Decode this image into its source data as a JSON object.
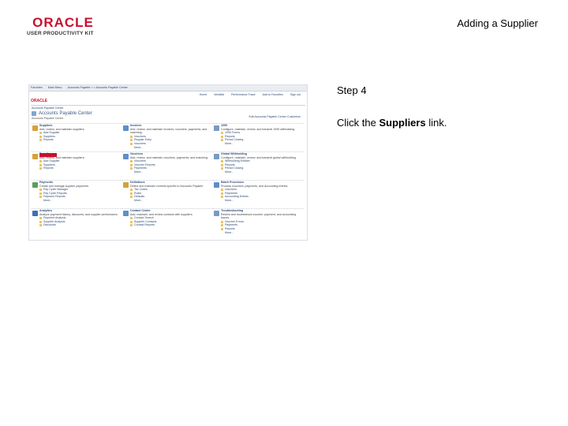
{
  "header": {
    "logo_top": "ORACLE",
    "logo_sub": "USER PRODUCTIVITY KIT",
    "doc_title": "Adding a Supplier"
  },
  "step": {
    "label": "Step 4",
    "instruction_prefix": "Click the ",
    "instruction_target": "Suppliers",
    "instruction_suffix": " link."
  },
  "screenshot": {
    "topbar_items": [
      "Favorites",
      "Main Menu",
      "Accounts Payable > > Accounts Payable Center"
    ],
    "nav_items": [
      "Home",
      "Worklist",
      "Performance Trace",
      "Add to Favorites",
      "Sign out"
    ],
    "brand": "ORACLE",
    "crumb": "Accounts Payable Center",
    "center_title": "Accounts Payable Center",
    "right_links": "Edit Accounts Payable Center   Customize",
    "context": "Accounts Payable Center",
    "sections": [
      {
        "title": "Suppliers",
        "desc": "Add, review, and maintain suppliers.",
        "links": [
          "Add Supplier",
          "Suppliers",
          "Reports"
        ],
        "more": "",
        "color": "#d6a23a"
      },
      {
        "title": "Invoices",
        "desc": "Add, review, and maintain invoices, vouchers, payments, and matching.",
        "links": [
          "Vouchers",
          "Regular Entry",
          "Vouchers"
        ],
        "more": "More...",
        "color": "#5d8fc9"
      },
      {
        "title": "1099",
        "desc": "Configure, maintain, review, and transmit 1099 withholding.",
        "links": [
          "1099 Forms",
          "Reports",
          "Period Closing"
        ],
        "more": "More...",
        "color": "#7a9bc1"
      },
      {
        "title": "Suppliers",
        "desc": "Add, review, and maintain suppliers.",
        "links": [
          "Add Supplier",
          "Suppliers",
          "Reports"
        ],
        "more": "",
        "color": "#d6a23a"
      },
      {
        "title": "Vouchers",
        "desc": "Add, review, and maintain vouchers, payments, and matching.",
        "links": [
          "Vouchers",
          "Voucher Reports",
          "Payments"
        ],
        "more": "More...",
        "color": "#5d8fc9"
      },
      {
        "title": "Global Withholding",
        "desc": "Configure, maintain, review, and transmit global withholding.",
        "links": [
          "Withholding Entities",
          "Reports",
          "Period Closing"
        ],
        "more": "More...",
        "color": "#7a9bc1"
      },
      {
        "title": "Payments",
        "desc": "Create and manage supplier payments.",
        "links": [
          "Pay Cycle Manager",
          "Pay Cycle Reports",
          "Payment Reports"
        ],
        "more": "More...",
        "color": "#5a9f5a"
      },
      {
        "title": "Definitions",
        "desc": "Define and maintain controls specific to Accounts Payable.",
        "links": [
          "Tax Codes",
          "Rules",
          "Defaults"
        ],
        "more": "More...",
        "color": "#d6a23a"
      },
      {
        "title": "Batch Processes",
        "desc": "Process vouchers, payments, and accounting entries.",
        "links": [
          "Vouchers",
          "Payments",
          "Accounting Entries"
        ],
        "more": "More...",
        "color": "#5d8fc9"
      },
      {
        "title": "Analytics",
        "desc": "Analyze payment history, discounts, and supplier performance.",
        "links": [
          "Payment Analysis",
          "Supplier Analysis",
          "Discounts"
        ],
        "more": "",
        "color": "#3f6fb0"
      },
      {
        "title": "Contact Center",
        "desc": "Add, maintain, and review contacts with suppliers.",
        "links": [
          "Contact Search",
          "Supplier Contacts",
          "Contact Reports"
        ],
        "more": "",
        "color": "#5d8fc9"
      },
      {
        "title": "Troubleshooting",
        "desc": "Review and troubleshoot voucher, payment, and accounting issues.",
        "links": [
          "Voucher Errors",
          "Payments",
          "Reports"
        ],
        "more": "More...",
        "color": "#7a9bc1"
      }
    ]
  }
}
